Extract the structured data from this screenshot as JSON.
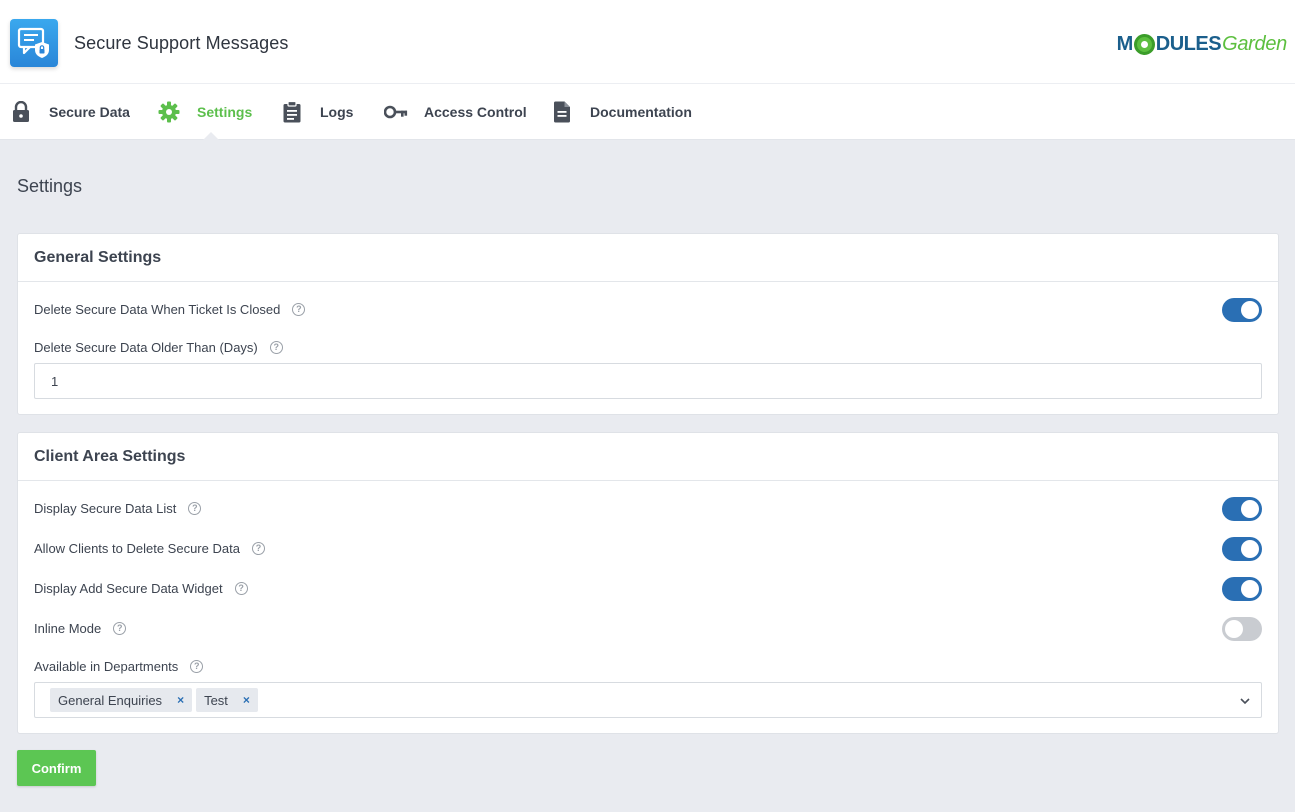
{
  "header": {
    "title": "Secure Support Messages",
    "app_icon": "secure-messages-icon",
    "brand": {
      "part1": "M",
      "part2": "DULES",
      "part3": "Garden"
    }
  },
  "tabs": [
    {
      "label": "Secure Data",
      "icon": "lock-icon",
      "active": false
    },
    {
      "label": "Settings",
      "icon": "gear-icon",
      "active": true
    },
    {
      "label": "Logs",
      "icon": "clipboard-icon",
      "active": false
    },
    {
      "label": "Access Control",
      "icon": "key-icon",
      "active": false
    },
    {
      "label": "Documentation",
      "icon": "document-icon",
      "active": false
    }
  ],
  "page": {
    "title": "Settings"
  },
  "general": {
    "heading": "General Settings",
    "delete_on_close": {
      "label": "Delete Secure Data When Ticket Is Closed",
      "enabled": true
    },
    "delete_older": {
      "label": "Delete Secure Data Older Than (Days)",
      "value": "1"
    }
  },
  "client_area": {
    "heading": "Client Area Settings",
    "display_list": {
      "label": "Display Secure Data List",
      "enabled": true
    },
    "allow_delete": {
      "label": "Allow Clients to Delete Secure Data",
      "enabled": true
    },
    "display_widget": {
      "label": "Display Add Secure Data Widget",
      "enabled": true
    },
    "inline_mode": {
      "label": "Inline Mode",
      "enabled": false
    },
    "departments": {
      "label": "Available in Departments",
      "selected": [
        "General Enquiries",
        "Test"
      ],
      "remove_glyph": "×"
    }
  },
  "actions": {
    "confirm": "Confirm"
  },
  "colors": {
    "accent_green": "#5cc653",
    "toggle_on": "#2a6fb4",
    "toggle_off": "#c9ccd1"
  },
  "help_glyph": "?"
}
